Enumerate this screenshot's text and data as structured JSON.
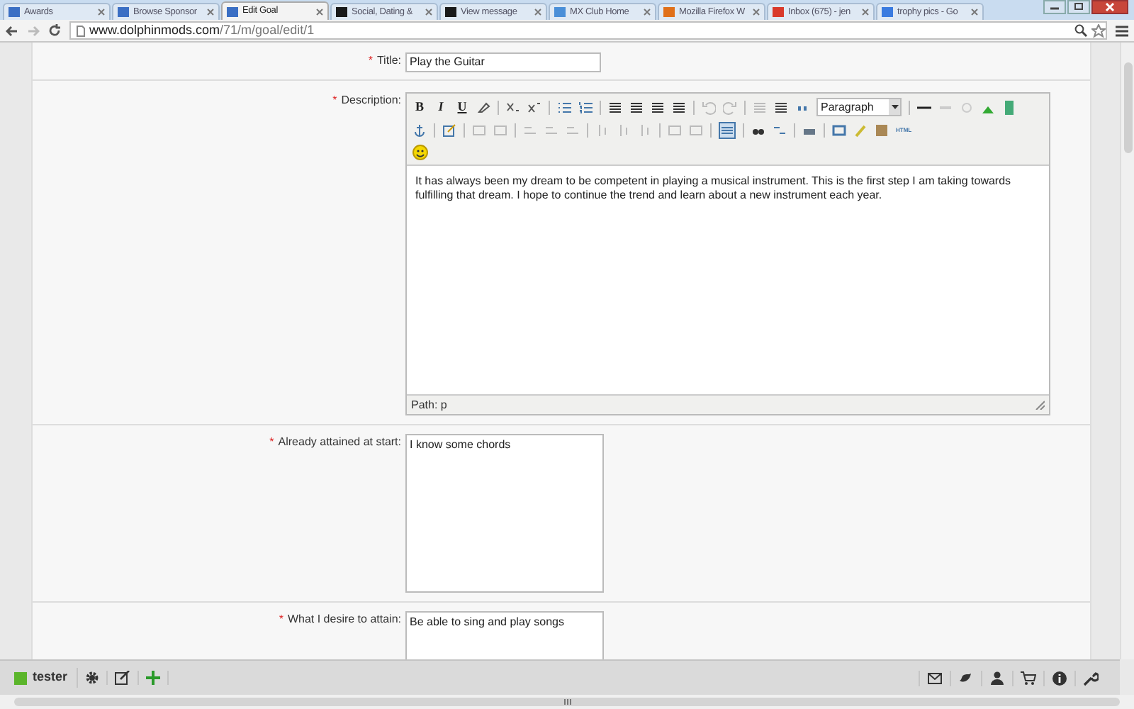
{
  "tabs": [
    {
      "label": "Awards",
      "selected": false,
      "color": "#3b6fc4"
    },
    {
      "label": "Browse Sponsor",
      "selected": false,
      "color": "#3b6fc4"
    },
    {
      "label": "Edit Goal",
      "selected": true,
      "color": "#3b6fc4"
    },
    {
      "label": "Social, Dating &",
      "selected": false,
      "color": "#1a1a1a"
    },
    {
      "label": "View message",
      "selected": false,
      "color": "#1a1a1a"
    },
    {
      "label": "MX Club Home",
      "selected": false,
      "color": "#4a8fd8"
    },
    {
      "label": "Mozilla Firefox W",
      "selected": false,
      "color": "#e0701a"
    },
    {
      "label": "Inbox (675) - jen",
      "selected": false,
      "color": "#d93a2b"
    },
    {
      "label": "trophy pics - Go",
      "selected": false,
      "color": "#3a7be0"
    }
  ],
  "address_bar": {
    "host": "www.dolphinmods.com",
    "path": "/71/m/goal/edit/1"
  },
  "form": {
    "title": {
      "required_mark": "*",
      "label": "Title:",
      "value": "Play the Guitar"
    },
    "description": {
      "required_mark": "*",
      "label": "Description:",
      "toolbar_text": [
        "B",
        "I",
        "U"
      ],
      "format_select": "Paragraph",
      "html_button": "HTML",
      "text": "It has always been my dream to be competent in playing a musical instrument. This is the first step I am taking towards fulfilling that dream. I hope to continue the trend and learn about a new instrument each year.",
      "path": "Path: p"
    },
    "fields": [
      {
        "required_mark": "*",
        "label": "Already attained at start:",
        "value": "I know some chords"
      },
      {
        "required_mark": "*",
        "label": "What I desire to attain:",
        "value": "Be able to sing and play songs"
      }
    ]
  },
  "bottom_bar": {
    "user": "tester"
  }
}
